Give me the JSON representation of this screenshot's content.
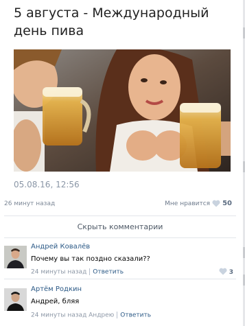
{
  "post": {
    "title": "5 августа - Международный день пива",
    "date": "05.08.16, 12:56",
    "ago": "26 минут назад",
    "likes_label": "Мне нравится",
    "likes_count": "50"
  },
  "comments_toggle": "Скрыть комментарии",
  "comments": [
    {
      "author": "Андрей Ковалёв",
      "text": "Почему вы так поздно сказали??",
      "time": "24 минуты назад",
      "reply": "Ответить",
      "likes": "3"
    },
    {
      "author": "Артём Родкин",
      "text": "Андрей, бляя",
      "time": "24 минуты назад Андрею",
      "reply": "Ответить"
    }
  ],
  "colors": {
    "link": "#2a5885",
    "muted": "#8b96a5",
    "heart": "#c9d3df"
  }
}
